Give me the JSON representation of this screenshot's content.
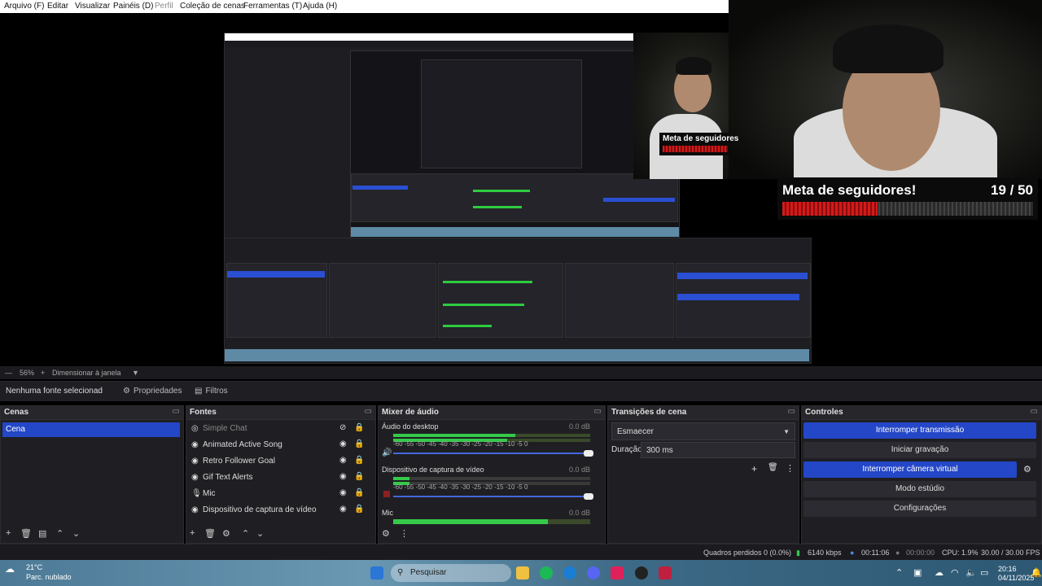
{
  "menu": {
    "items": [
      "Arquivo (F)",
      "Editar",
      "Visualizar",
      "Painéis (D)",
      "Perfil",
      "Coleção de cenas",
      "Ferramentas (T)",
      "Ajuda (H)"
    ]
  },
  "preview": {
    "goal_title": "Meta de seguidores!",
    "goal_count": "19 / 50",
    "goal_progress": 0.38,
    "goal_small_title": "Meta de seguidores"
  },
  "zoom": {
    "percent": "56%",
    "mode": "Dimensionar à janela"
  },
  "propbar": {
    "no_source": "Nenhuma fonte selecionad",
    "properties": "Propriedades",
    "filters": "Filtros"
  },
  "scenes": {
    "title": "Cenas",
    "items": [
      "Cena"
    ]
  },
  "sources": {
    "title": "Fontes",
    "items": [
      {
        "icon": "chat",
        "label": "Simple Chat"
      },
      {
        "icon": "browser",
        "label": "Animated Active Song"
      },
      {
        "icon": "browser",
        "label": "Retro Follower Goal"
      },
      {
        "icon": "browser",
        "label": "Gif Text Alerts"
      },
      {
        "icon": "mic",
        "label": "Mic"
      },
      {
        "icon": "browser",
        "label": "Dispositivo de captura de vídeo"
      }
    ]
  },
  "mixer": {
    "title": "Mixer de áudio",
    "channels": [
      {
        "name": "Áudio do desktop",
        "db": "0.0 dB"
      },
      {
        "name": "Dispositivo de captura de vídeo",
        "db": "0.0 dB"
      },
      {
        "name": "Mic",
        "db": "0.0 dB"
      }
    ],
    "scale": [
      "-60",
      "-55",
      "-50",
      "-45",
      "-40",
      "-35",
      "-30",
      "-25",
      "-20",
      "-15",
      "-10",
      "-5",
      "0"
    ]
  },
  "transitions": {
    "title": "Transições de cena",
    "selected": "Esmaecer",
    "duration_label": "Duração",
    "duration_value": "300 ms"
  },
  "controls": {
    "title": "Controles",
    "buttons": [
      {
        "label": "Interromper transmissão",
        "active": true
      },
      {
        "label": "Iniciar gravação",
        "active": false
      },
      {
        "label": "Interromper câmera virtual",
        "active": true
      },
      {
        "label": "Modo estúdio",
        "active": false
      },
      {
        "label": "Configurações",
        "active": false
      }
    ]
  },
  "status": {
    "dropped": "Quadros perdidos 0 (0.0%)",
    "bitrate": "6140 kbps",
    "stream_time": "00:11:06",
    "rec_time": "00:00:00",
    "cpu": "CPU: 1.9%",
    "fps": "30.00 / 30.00 FPS"
  },
  "taskbar": {
    "temp": "21°C",
    "weather": "Parc. nublado",
    "search": "Pesquisar",
    "time": "20:16",
    "date": "04/11/2025"
  }
}
